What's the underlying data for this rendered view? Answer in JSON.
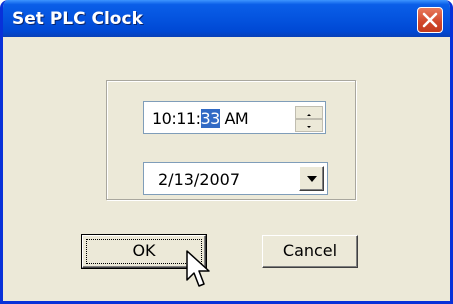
{
  "window": {
    "title": "Set PLC Clock"
  },
  "time_picker": {
    "hours_minutes": "10:11:",
    "seconds_selected": "33",
    "ampm": " AM"
  },
  "date_picker": {
    "value": "2/13/2007"
  },
  "buttons": {
    "ok": "OK",
    "cancel": "Cancel"
  },
  "colors": {
    "title_bar": "#0555e0",
    "close_button": "#d0462a",
    "selection": "#316ac5",
    "dialog_bg": "#ece9d8"
  },
  "icons": {
    "close": "close-icon",
    "spin_up": "spin-up-icon",
    "spin_down": "spin-down-icon",
    "dropdown": "chevron-down-icon",
    "cursor": "mouse-pointer-icon"
  }
}
